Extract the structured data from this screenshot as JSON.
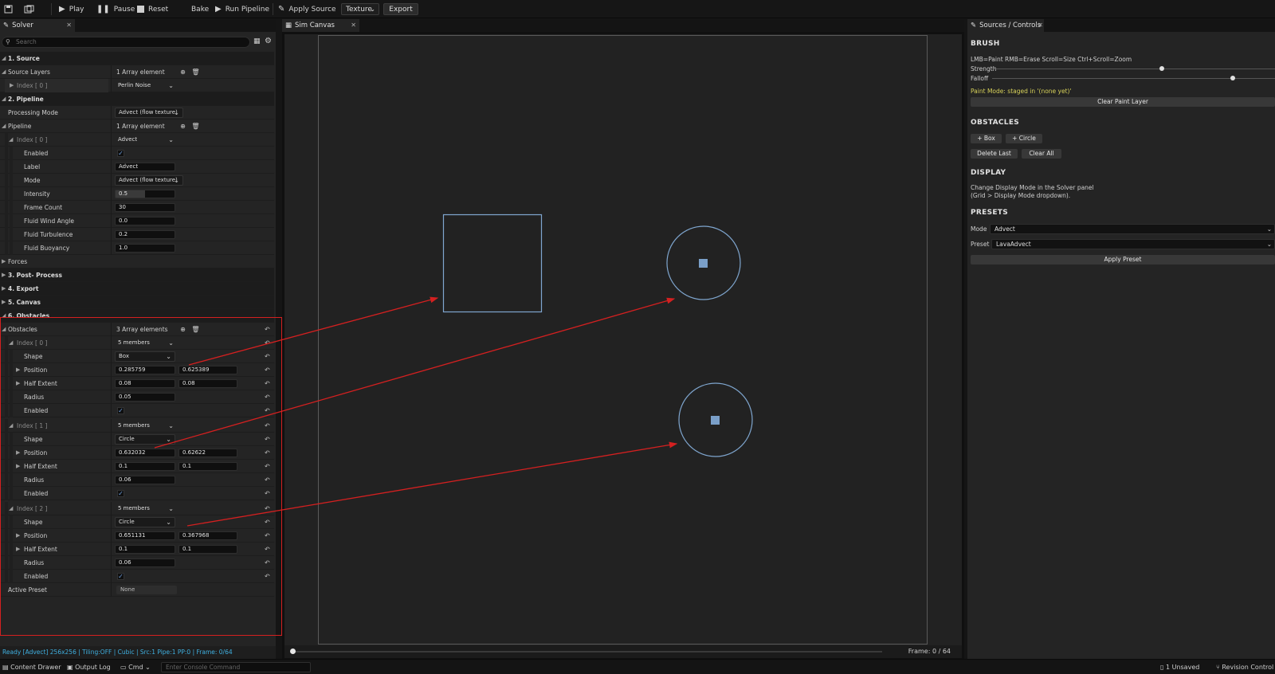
{
  "toolbar": {
    "play": "Play",
    "pause": "Pause",
    "reset": "Reset",
    "bake": "Bake",
    "run_pipeline": "Run Pipeline",
    "apply_source": "Apply Source",
    "texture_dropdown": "Texture",
    "export": "Export"
  },
  "tabs": {
    "solver": "Solver",
    "sim_canvas": "Sim Canvas",
    "sources": "Sources / Controls"
  },
  "solver": {
    "search_placeholder": "Search",
    "source": {
      "header": "1. Source",
      "source_layers": "Source Layers",
      "array_count": "1 Array element",
      "index0": "Index [ 0 ]",
      "index0_value": "Perlin Noise"
    },
    "pipeline": {
      "header": "2. Pipeline",
      "processing_mode": "Processing Mode",
      "processing_mode_value": "Advect (flow texture)",
      "pipeline_label": "Pipeline",
      "pipeline_count": "1 Array element",
      "index0": "Index [ 0 ]",
      "index0_value": "Advect",
      "enabled": "Enabled",
      "label": "Label",
      "label_value": "Advect",
      "mode": "Mode",
      "mode_value": "Advect (flow texture)",
      "intensity": "Intensity",
      "intensity_value": "0.5",
      "frame_count": "Frame Count",
      "frame_count_value": "30",
      "wind_angle": "Fluid Wind Angle",
      "wind_angle_value": "0.0",
      "turbulence": "Fluid Turbulence",
      "turbulence_value": "0.2",
      "buoyancy": "Fluid Buoyancy",
      "buoyancy_value": "1.0"
    },
    "forces": "Forces",
    "post_process": "3. Post- Process",
    "export": "4. Export",
    "canvas": "5. Canvas",
    "obstacles": {
      "header": "6. Obstacles",
      "label": "Obstacles",
      "count": "3 Array elements",
      "items": [
        {
          "index": "Index [ 0 ]",
          "members": "5 members",
          "shape": "Box",
          "pos_x": "0.285759",
          "pos_y": "0.625389",
          "half_x": "0.08",
          "half_y": "0.08",
          "radius": "0.05"
        },
        {
          "index": "Index [ 1 ]",
          "members": "5 members",
          "shape": "Circle",
          "pos_x": "0.632032",
          "pos_y": "0.62622",
          "half_x": "0.1",
          "half_y": "0.1",
          "radius": "0.06"
        },
        {
          "index": "Index [ 2 ]",
          "members": "5 members",
          "shape": "Circle",
          "pos_x": "0.651131",
          "pos_y": "0.367968",
          "half_x": "0.1",
          "half_y": "0.1",
          "radius": "0.06"
        }
      ],
      "shape_label": "Shape",
      "position_label": "Position",
      "half_extent_label": "Half Extent",
      "radius_label": "Radius",
      "enabled_label": "Enabled"
    },
    "active_preset": "Active Preset",
    "active_preset_value": "None",
    "status": "Ready [Advect] 256x256 | Tiling:OFF | Cubic | Src:1 Pipe:1 PP:0 | Frame: 0/64"
  },
  "canvas": {
    "frame_label": "Frame: 0 / 64",
    "timeline_progress": 0
  },
  "controls": {
    "brush_header": "BRUSH",
    "brush_help": "LMB=Paint  RMB=Erase  Scroll=Size  Ctrl+Scroll=Zoom",
    "strength": "Strength",
    "strength_value": 0.6,
    "falloff": "Falloff",
    "falloff_value": 0.85,
    "paint_mode": "Paint Mode: staged in '(none yet)'",
    "clear_paint": "Clear Paint Layer",
    "obstacles_header": "OBSTACLES",
    "add_box": "+ Box",
    "add_circle": "+ Circle",
    "delete_last": "Delete Last",
    "clear_all": "Clear All",
    "display_header": "DISPLAY",
    "display_line1": "Change Display Mode in the Solver panel",
    "display_line2": "(Grid > Display Mode dropdown).",
    "presets_header": "PRESETS",
    "mode_label": "Mode",
    "mode_value": "Advect",
    "preset_label": "Preset",
    "preset_value": "LavaAdvect",
    "apply_preset": "Apply Preset"
  },
  "bottom": {
    "content_drawer": "Content Drawer",
    "output_log": "Output Log",
    "cmd": "Cmd",
    "console_placeholder": "Enter Console Command",
    "unsaved": "1 Unsaved",
    "revision_control": "Revision Control"
  },
  "colors": {
    "annotation": "#d42020",
    "obstacle_stroke": "#7fa6cf",
    "obstacle_marker": "#7a9fc8",
    "paint_mode_text": "#d8d25a",
    "status_text": "#3fb0e0"
  }
}
